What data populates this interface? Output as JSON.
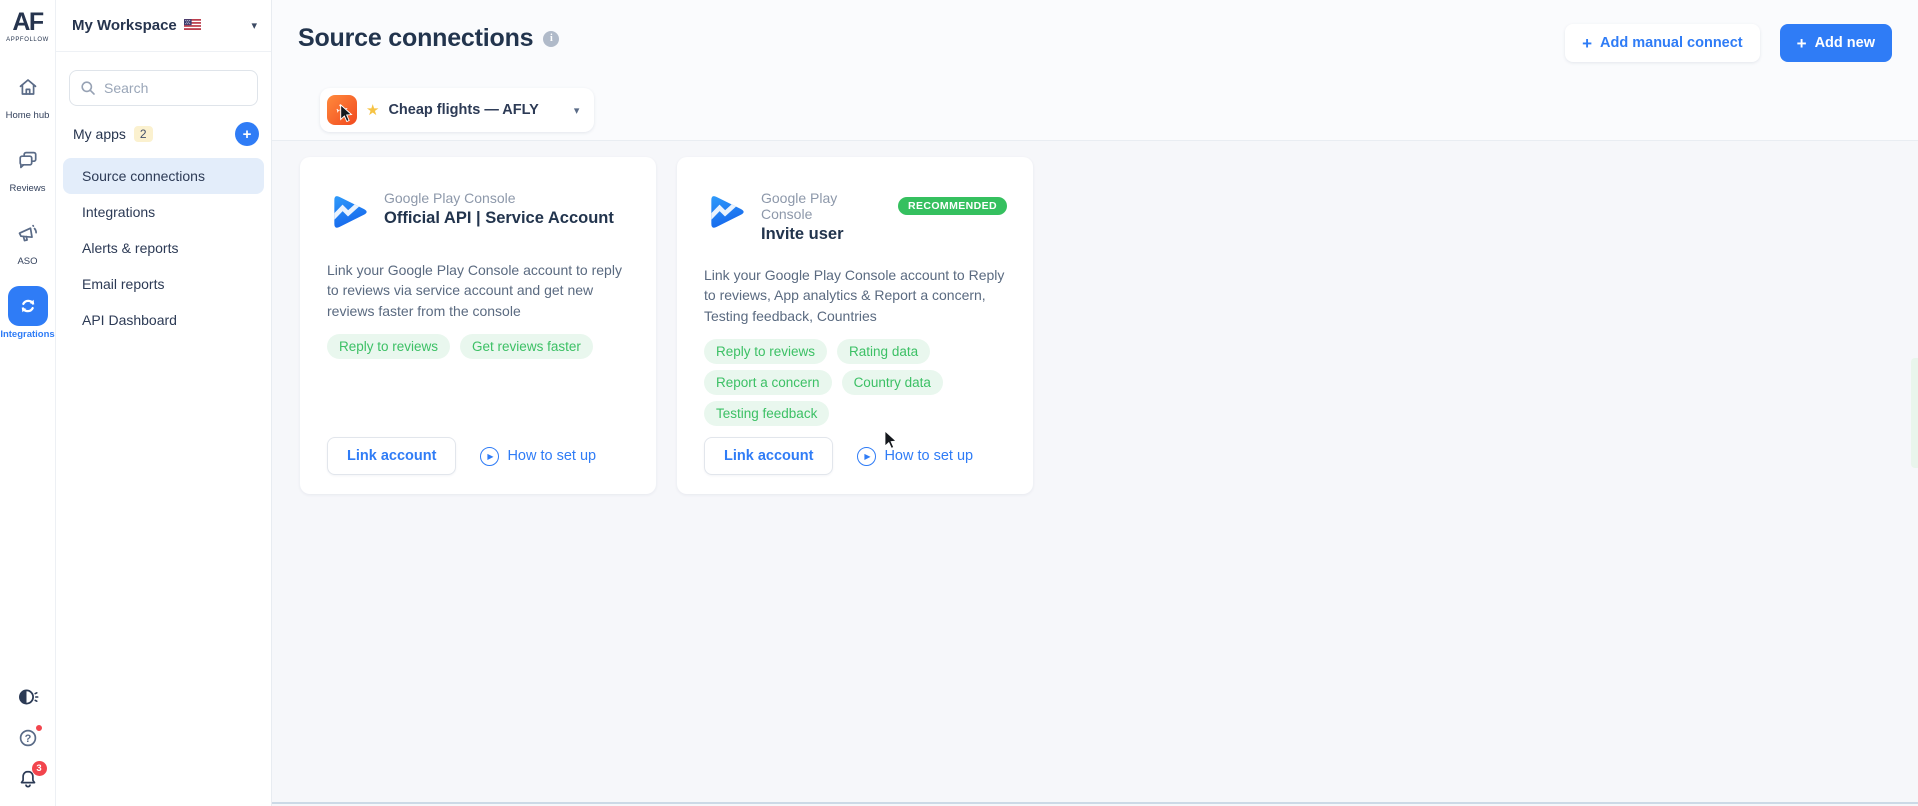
{
  "brand": {
    "logo": "AF",
    "name": "APPFOLLOW"
  },
  "workspace": {
    "name": "My Workspace"
  },
  "rail": {
    "items": [
      {
        "label": "Home hub"
      },
      {
        "label": "Reviews"
      },
      {
        "label": "ASO"
      },
      {
        "label": "Integrations"
      }
    ],
    "notifications_count": "3"
  },
  "sidebar": {
    "search_placeholder": "Search",
    "my_apps": {
      "label": "My apps",
      "count": "2"
    },
    "items": [
      {
        "label": "Source connections"
      },
      {
        "label": "Integrations"
      },
      {
        "label": "Alerts & reports"
      },
      {
        "label": "Email reports"
      },
      {
        "label": "API Dashboard"
      }
    ]
  },
  "header": {
    "title": "Source connections",
    "buttons": {
      "add_manual": "Add manual connect",
      "add_new": "Add new"
    }
  },
  "app_selector": {
    "name": "Cheap flights — AFLY"
  },
  "cards": [
    {
      "provider": "Google Play Console",
      "title": "Official API | Service Account",
      "badge": "",
      "description": "Link your Google Play Console account to reply to reviews via service account and get new reviews faster from the console",
      "tags": [
        "Reply to reviews",
        "Get reviews faster"
      ],
      "link_button": "Link account",
      "howto_label": "How to set up"
    },
    {
      "provider": "Google Play Console",
      "title": "Invite user",
      "badge": "RECOMMENDED",
      "description": "Link your Google Play Console account to Reply to reviews, App analytics & Report a concern, Testing feedback, Countries",
      "tags": [
        "Reply to reviews",
        "Rating data",
        "Report a concern",
        "Country data",
        "Testing feedback"
      ],
      "link_button": "Link account",
      "howto_label": "How to set up"
    }
  ],
  "icons": {
    "plus": "+",
    "info": "i",
    "star": "★",
    "caret_down": "▾",
    "play": "▶",
    "plane": "✈",
    "question": "?"
  },
  "colors": {
    "primary_blue": "#2f7cf6",
    "tag_green": "#3cc065",
    "badge_green": "#35c05f",
    "navy": "#22344d"
  }
}
